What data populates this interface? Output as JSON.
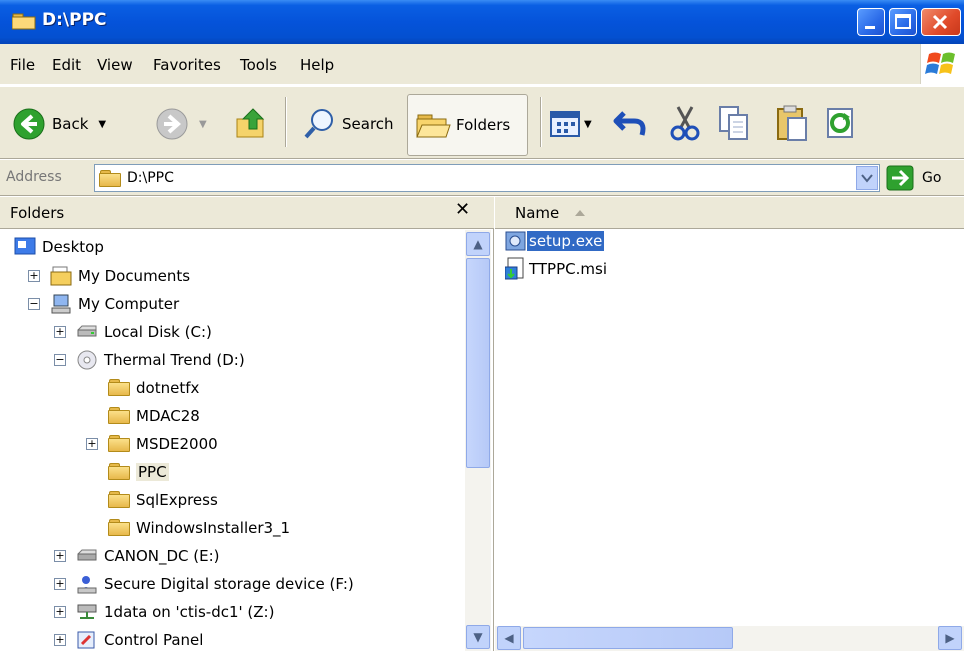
{
  "window": {
    "title": "D:\\PPC"
  },
  "menu": {
    "items": [
      {
        "label": "File",
        "underline": "F"
      },
      {
        "label": "Edit",
        "underline": "E"
      },
      {
        "label": "View",
        "underline": "V"
      },
      {
        "label": "Favorites",
        "underline": "a"
      },
      {
        "label": "Tools",
        "underline": "T"
      },
      {
        "label": "Help",
        "underline": "H"
      }
    ]
  },
  "toolbar": {
    "back_label": "Back",
    "search_label": "Search",
    "folders_label": "Folders"
  },
  "address": {
    "label": "Address",
    "value": "D:\\PPC",
    "go_label": "Go"
  },
  "folders_pane": {
    "title": "Folders",
    "close_glyph": "✕",
    "tree": [
      {
        "label": "Desktop",
        "icon": "desktop-icon"
      },
      {
        "label": "My Documents",
        "icon": "my-documents-icon",
        "expander": "+"
      },
      {
        "label": "My Computer",
        "icon": "my-computer-icon",
        "expander": "−"
      },
      {
        "label": "Local Disk (C:)",
        "icon": "hard-drive-icon",
        "expander": "+"
      },
      {
        "label": "Thermal Trend (D:)",
        "icon": "cd-drive-icon",
        "expander": "−"
      },
      {
        "label": "dotnetfx",
        "icon": "folder-icon"
      },
      {
        "label": "MDAC28",
        "icon": "folder-icon"
      },
      {
        "label": "MSDE2000",
        "icon": "folder-icon",
        "expander": "+"
      },
      {
        "label": "PPC",
        "icon": "open-folder-icon",
        "selected": true
      },
      {
        "label": "SqlExpress",
        "icon": "folder-icon"
      },
      {
        "label": "WindowsInstaller3_1",
        "icon": "folder-icon"
      },
      {
        "label": "CANON_DC (E:)",
        "icon": "removable-drive-icon",
        "expander": "+"
      },
      {
        "label": "Secure Digital storage device (F:)",
        "icon": "sd-card-icon",
        "expander": "+"
      },
      {
        "label": "1data on 'ctis-dc1' (Z:)",
        "icon": "network-drive-icon",
        "expander": "+"
      },
      {
        "label": "Control Panel",
        "icon": "control-panel-icon",
        "expander": "+"
      }
    ]
  },
  "files_pane": {
    "column_name": "Name",
    "files": [
      {
        "name": "setup.exe",
        "icon": "setup-exe-icon",
        "selected": true
      },
      {
        "name": "TTPPC.msi",
        "icon": "msi-installer-icon",
        "selected": false
      }
    ]
  },
  "colors": {
    "titlebar": "#0553da",
    "chrome": "#ece9d8",
    "selection": "#316ac5"
  }
}
